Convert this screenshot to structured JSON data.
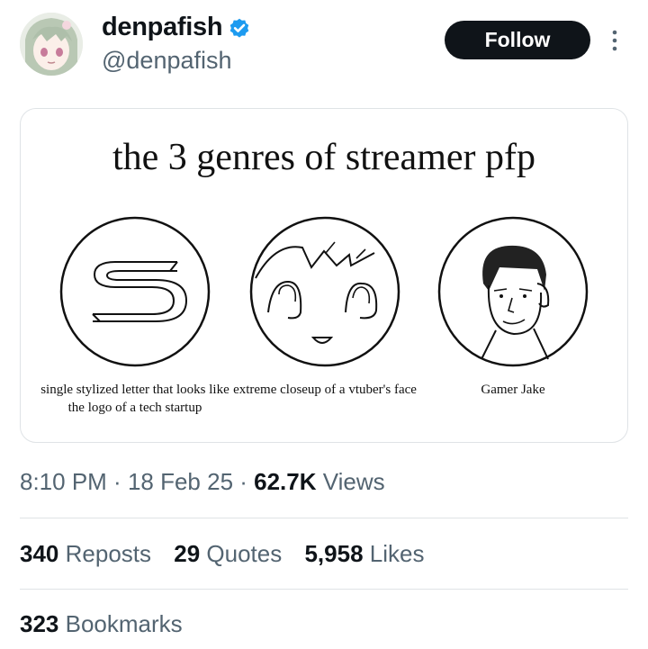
{
  "author": {
    "display_name": "denpafish",
    "handle": "@denpafish",
    "verified": true
  },
  "follow_label": "Follow",
  "card": {
    "title": "the 3 genres of streamer pfp",
    "panels": [
      {
        "caption": "single stylized letter that looks like the logo of a tech startup",
        "icon": "stylized-s-logo"
      },
      {
        "caption": "extreme closeup of a vtuber's face",
        "icon": "anime-face-closeup"
      },
      {
        "caption": "Gamer Jake",
        "icon": "gamer-portrait-sketch"
      }
    ]
  },
  "meta": {
    "time": "8:10 PM",
    "date": "18 Feb 25",
    "views_count": "62.7K",
    "views_label": "Views",
    "separator": " · "
  },
  "stats": {
    "reposts": {
      "count": "340",
      "label": "Reposts"
    },
    "quotes": {
      "count": "29",
      "label": "Quotes"
    },
    "likes": {
      "count": "5,958",
      "label": "Likes"
    },
    "bookmarks": {
      "count": "323",
      "label": "Bookmarks"
    }
  },
  "colors": {
    "text_primary": "#0f1419",
    "text_secondary": "#536471",
    "verified_blue": "#1d9bf0",
    "divider": "#dfe3e6"
  }
}
